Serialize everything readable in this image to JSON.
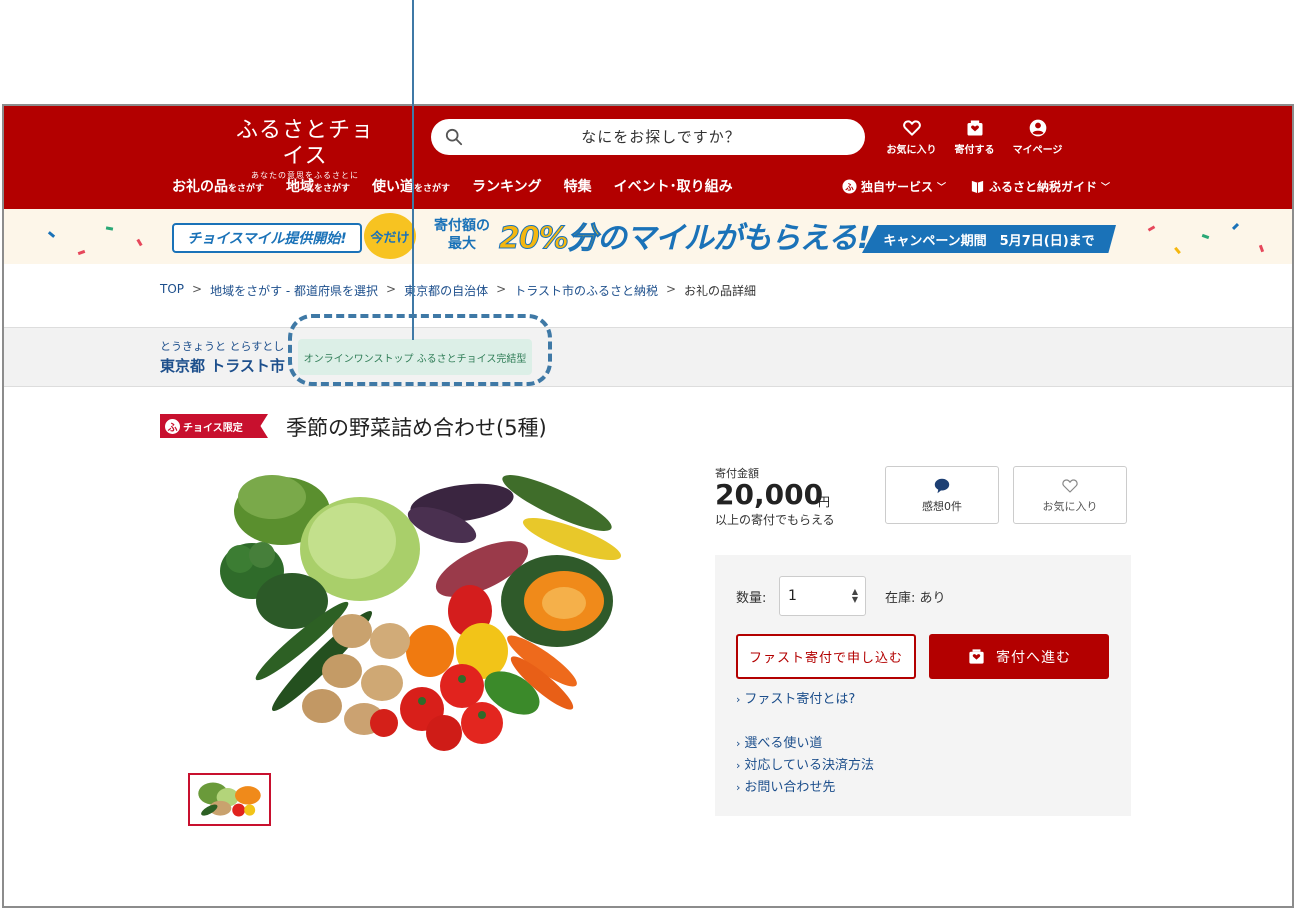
{
  "header": {
    "logo_main": "ふるさとチョイス",
    "logo_sub": "あなたの意思をふるさとに",
    "search_placeholder": "なにをお探しですか？",
    "actions": [
      {
        "label": "お気に入り",
        "icon": "heart-icon"
      },
      {
        "label": "寄付する",
        "icon": "donate-box-icon"
      },
      {
        "label": "マイページ",
        "icon": "user-icon"
      }
    ],
    "nav": [
      {
        "main": "お礼の品",
        "sub": "をさがす"
      },
      {
        "main": "地域",
        "sub": "をさがす"
      },
      {
        "main": "使い道",
        "sub": "をさがす"
      },
      {
        "main": "ランキング",
        "sub": ""
      },
      {
        "main": "特集",
        "sub": ""
      },
      {
        "main": "イベント･取り組み",
        "sub": ""
      }
    ],
    "nav_right": [
      {
        "label": "独自サービス",
        "icon": "furusato-logo-icon"
      },
      {
        "label": "ふるさと納税ガイド",
        "icon": "book-icon"
      }
    ]
  },
  "banner": {
    "left": "チョイスマイル提供開始!",
    "ima": "今だけ",
    "small_line1": "寄付額の",
    "small_line2": "最大",
    "pct": "20%分",
    "rest": "のマイルがもらえる!",
    "period": "キャンペーン期間　5月7日(日)まで"
  },
  "breadcrumb": {
    "items": [
      "TOP",
      "地域をさがす - 都道府県を選択",
      "東京都の自治体",
      "トラスト市のふるさと納税"
    ],
    "current": "お礼の品詳細",
    "separator": ">"
  },
  "municipality": {
    "kana": "とうきょうと とらすとし",
    "name": "東京都 トラスト市",
    "onestop": "オンラインワンストップ ふるさとチョイス完結型"
  },
  "product": {
    "badge_icon_char": "ふ",
    "badge_text": "チョイス限定",
    "title": "季節の野菜詰め合わせ(5種)",
    "price_label": "寄付金額",
    "price": "20,000",
    "unit": "円",
    "price_note": "以上の寄付でもらえる",
    "reviews_label": "感想0件",
    "favorite_label": "お気に入り"
  },
  "panel": {
    "qty_label": "数量:",
    "qty_value": "1",
    "stock": "在庫: あり",
    "fast_button": "ファスト寄付で申し込む",
    "donate_button": "寄付へ進む",
    "links": [
      "ファスト寄付とは?",
      "選べる使い道",
      "対応している決済方法",
      "お問い合わせ先"
    ]
  },
  "colors": {
    "brand_red": "#b30000",
    "link_blue": "#1d4f8c",
    "annotation_blue": "#3f79a6",
    "badge_green_bg": "#dcefe7"
  }
}
